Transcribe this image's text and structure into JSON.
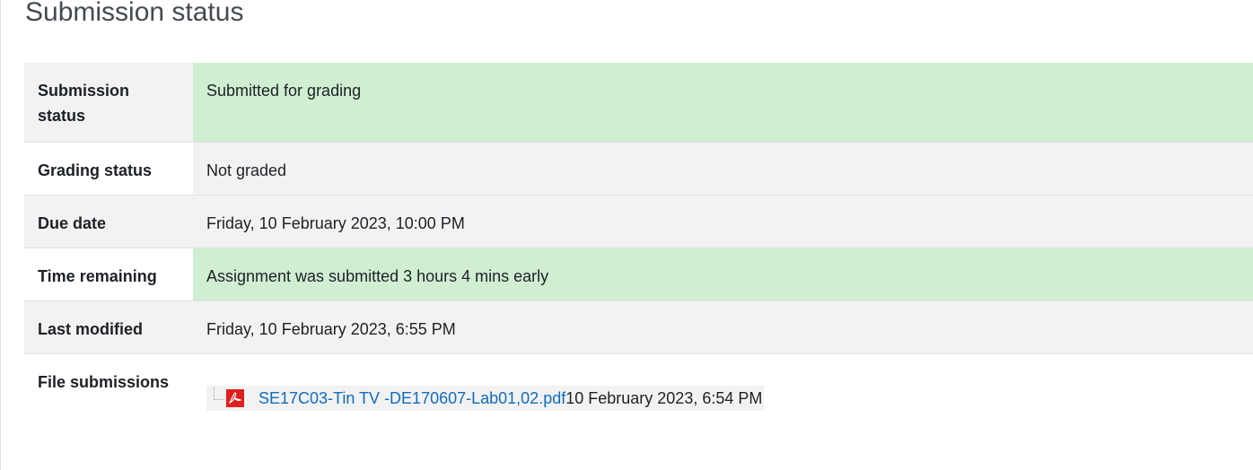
{
  "heading": "Submission status",
  "rows": [
    {
      "label": "Submission status",
      "value": "Submitted for grading"
    },
    {
      "label": "Grading status",
      "value": "Not graded"
    },
    {
      "label": "Due date",
      "value": "Friday, 10 February 2023, 10:00 PM"
    },
    {
      "label": "Time remaining",
      "value": "Assignment was submitted 3 hours 4 mins early"
    },
    {
      "label": "Last modified",
      "value": "Friday, 10 February 2023, 6:55 PM"
    },
    {
      "label": "File submissions"
    }
  ],
  "file": {
    "name": "SE17C03-Tin TV -DE170607-Lab01,02.pdf",
    "date": "10 February 2023, 6:54 PM",
    "icon": "pdf-icon"
  },
  "colors": {
    "success_bg": "#d0eed2",
    "stripe_bg": "#f2f2f2",
    "link": "#0f6cbf",
    "pdf_red": "#e01e1e"
  }
}
